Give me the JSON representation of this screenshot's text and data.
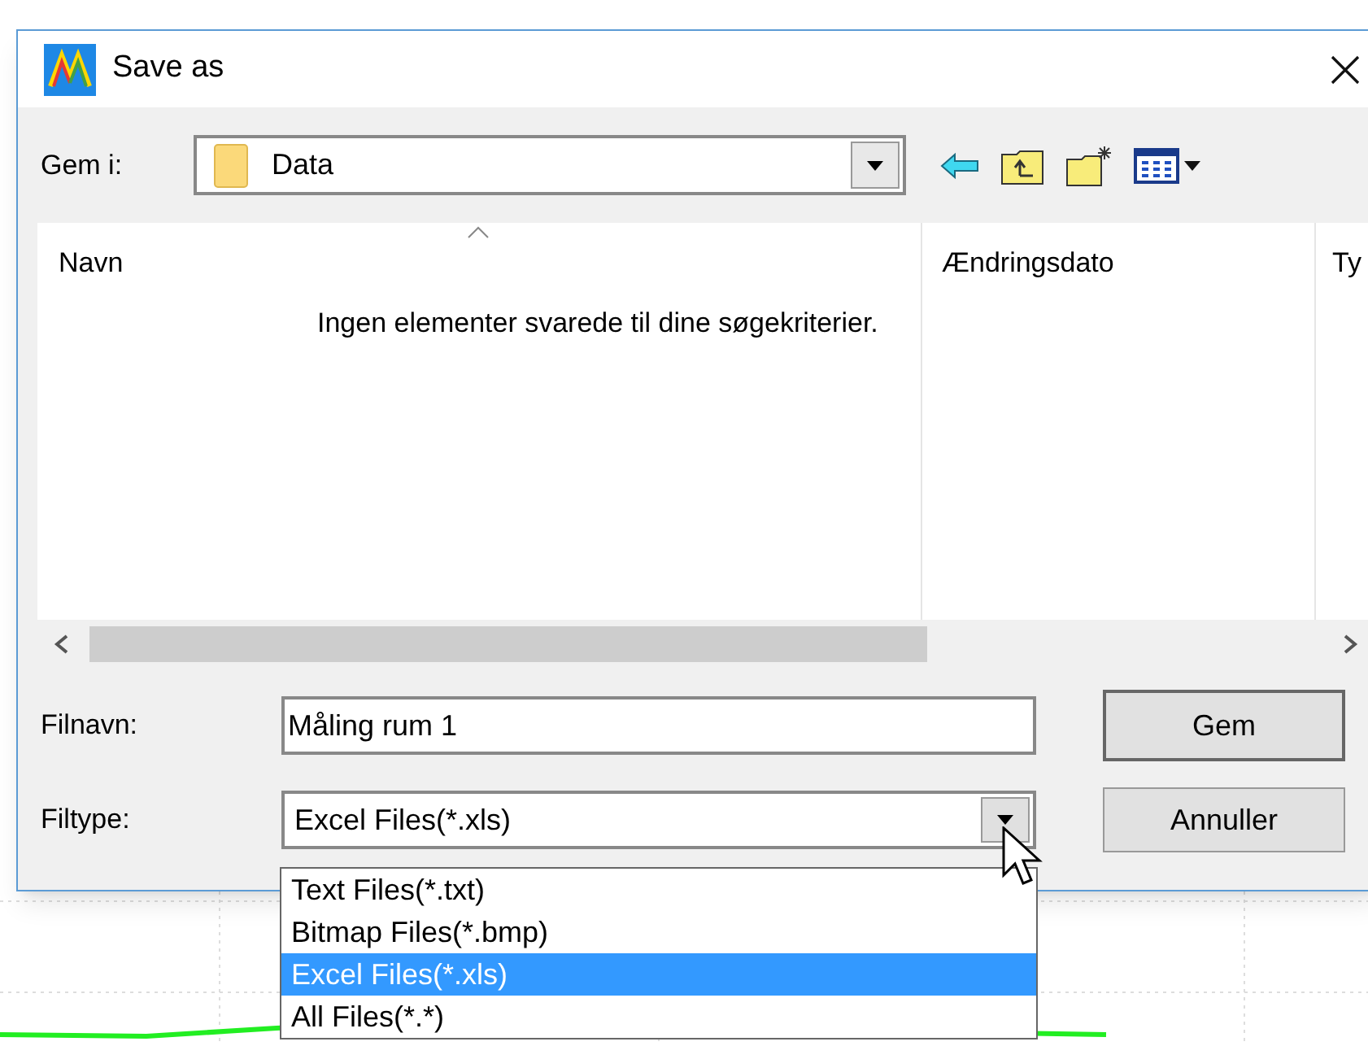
{
  "window": {
    "title": "Save as"
  },
  "location": {
    "label": "Gem i:",
    "value": "Data"
  },
  "file_list": {
    "columns": [
      "Navn",
      "Ændringsdato",
      "Ty"
    ],
    "empty_message": "Ingen elementer svarede til dine søgekriterier."
  },
  "filename": {
    "label": "Filnavn:",
    "value": "Måling rum 1"
  },
  "filetype": {
    "label": "Filtype:",
    "value": "Excel Files(*.xls)",
    "expanded": true,
    "options": [
      {
        "label": "Text Files(*.txt)",
        "selected": false
      },
      {
        "label": "Bitmap Files(*.bmp)",
        "selected": false
      },
      {
        "label": "Excel Files(*.xls)",
        "selected": true
      },
      {
        "label": "All Files(*.*)",
        "selected": false
      }
    ]
  },
  "buttons": [
    "Gem",
    "Annuller"
  ]
}
